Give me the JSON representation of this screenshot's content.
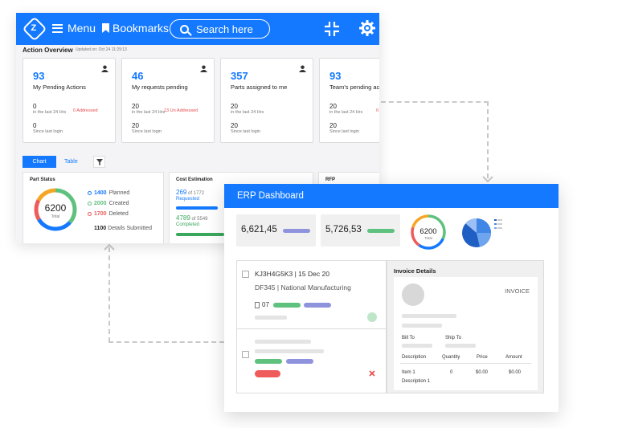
{
  "back_window": {
    "topbar": {
      "menu_label": "Menu",
      "bookmarks_label": "Bookmarks",
      "search_placeholder": "Search here",
      "logo_glyph": "Z"
    },
    "action_overview": {
      "title": "Action Overview",
      "updated": "Updated on: Oct 24 11:29:13"
    },
    "cards": [
      {
        "value": "93",
        "label": "My Pending Actions",
        "stat1_value": "0",
        "stat1_caption": "in the last 24 Hrs",
        "stat1_note": "0 Addressed",
        "stat2_value": "0",
        "stat2_caption": "Since last login"
      },
      {
        "value": "46",
        "label": "My requests pending",
        "stat1_value": "20",
        "stat1_caption": "in the last 24 Hrs",
        "stat1_note": "13 Un Addressed",
        "stat2_value": "20",
        "stat2_caption": "Since last login"
      },
      {
        "value": "357",
        "label": "Parts assigned to me",
        "stat1_value": "20",
        "stat1_caption": "in the last 24 Hrs",
        "stat1_note": "",
        "stat2_value": "20",
        "stat2_caption": "Since last login"
      },
      {
        "value": "93",
        "label": "Team's pending act",
        "stat1_value": "20",
        "stat1_caption": "in the last 24 Hrs",
        "stat1_note": "0",
        "stat2_value": "20",
        "stat2_caption": "Since last login"
      }
    ],
    "tabs": {
      "chart": "Chart",
      "table": "Table"
    },
    "part_status": {
      "title": "Part Status",
      "total_value": "6200",
      "total_label": "Total",
      "planned_value": "1400",
      "planned_label": "Planned",
      "created_value": "2000",
      "created_label": "Created",
      "deleted_value": "1700",
      "deleted_label": "Deleted",
      "submitted_value": "1100",
      "submitted_label": "Details Submitted"
    },
    "cost_estimation": {
      "title": "Cost Estimation",
      "requested_value": "269",
      "requested_of": "of 1772",
      "requested_label": "Requested",
      "completed_value": "4789",
      "completed_of": "of 5549",
      "completed_label": "Completed"
    },
    "rfp": {
      "title": "RFP"
    }
  },
  "front_window": {
    "title": "ERP Dashboard",
    "stats": [
      {
        "value": "6,621,45",
        "bar_color": "#8f93dd"
      },
      {
        "value": "5,726,53",
        "bar_color": "#5fc17e"
      }
    ],
    "donut": {
      "value": "6200",
      "label": "Total"
    },
    "list_item": {
      "id_line": "KJ3H4G5K3 | 15 Dec 20",
      "company_line": "DF345 | National Manufacturing",
      "count": "07"
    },
    "invoice": {
      "title": "Invoice Details",
      "heading": "INVOICE",
      "bill_to": "Bill To",
      "ship_to": "Ship To",
      "col_description": "Description",
      "col_quantity": "Quantity",
      "col_price": "Price",
      "col_amount": "Amount",
      "item_name": "Item 1",
      "item_desc": "Description 1",
      "item_qty": "0",
      "item_price": "$0.00",
      "item_amount": "$0.00"
    }
  },
  "colors": {
    "primary_blue": "#1479ff",
    "green": "#5fc17e",
    "purple": "#8f93dd",
    "red": "#ef5a5a"
  }
}
